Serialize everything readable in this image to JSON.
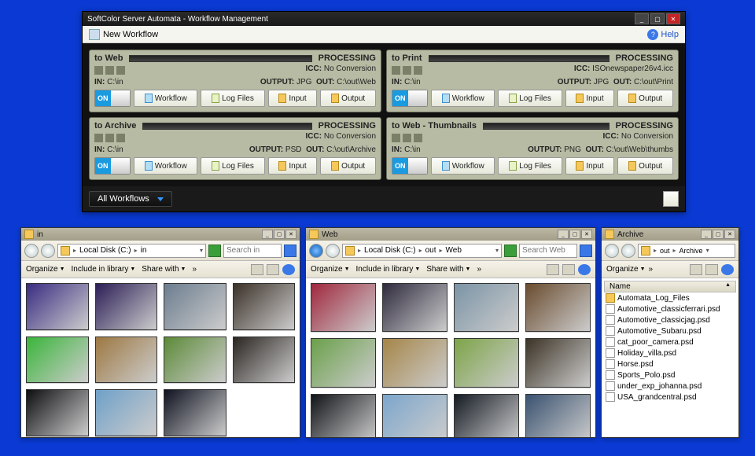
{
  "app": {
    "title": "SoftColor Server Automata - Workflow Management",
    "newWorkflow": "New Workflow",
    "help": "Help",
    "allWorkflows": "All Workflows"
  },
  "labels": {
    "in": "IN:",
    "out": "OUT:",
    "icc": "ICC:",
    "output": "OUTPUT:",
    "workflow": "Workflow",
    "logFiles": "Log Files",
    "input": "Input",
    "outputBtn": "Output",
    "on": "ON"
  },
  "workflows": [
    {
      "name": "to Web",
      "status": "PROCESSING",
      "icc": "No Conversion",
      "in": "C:\\in",
      "output": "JPG",
      "out": "C:\\out\\Web"
    },
    {
      "name": "to Print",
      "status": "PROCESSING",
      "icc": "ISOnewspaper26v4.icc",
      "in": "C:\\in",
      "output": "JPG",
      "out": "C:\\out\\Print"
    },
    {
      "name": "to Archive",
      "status": "PROCESSING",
      "icc": "No Conversion",
      "in": "C:\\in",
      "output": "PSD",
      "out": "C:\\out\\Archive"
    },
    {
      "name": "to Web - Thumbnails",
      "status": "PROCESSING",
      "icc": "No Conversion",
      "in": "C:\\in",
      "output": "PNG",
      "out": "C:\\out\\Web\\thumbs"
    }
  ],
  "explorer": {
    "organize": "Organize",
    "includeLib": "Include in library",
    "shareWith": "Share with",
    "nameCol": "Name"
  },
  "e1": {
    "title": "in",
    "breadcrumb": [
      "Local Disk (C:)",
      "in"
    ],
    "searchPlaceholder": "Search in",
    "thumbColors": [
      "#3a2c82",
      "#2b1e56",
      "#6c7d8f",
      "#3b3128",
      "#3ab53a",
      "#9d7842",
      "#5c8a38",
      "#2a2521",
      "#0e0e12",
      "#6fa0c8",
      "#0f1220"
    ]
  },
  "e2": {
    "title": "Web",
    "breadcrumb": [
      "Local Disk (C:)",
      "out",
      "Web"
    ],
    "searchPlaceholder": "Search Web",
    "thumbColors": [
      "#a0283e",
      "#2f2b3e",
      "#7b94a6",
      "#6a4c2f",
      "#6aa04a",
      "#a58548",
      "#7da448",
      "#3c3326",
      "#111418",
      "#7ca6cc",
      "#151b24",
      "#3a5270"
    ]
  },
  "e3": {
    "title": "Archive",
    "breadcrumb": [
      "out",
      "Archive"
    ],
    "files": [
      {
        "name": "Automata_Log_Files",
        "type": "folder"
      },
      {
        "name": "Automotive_classicferrari.psd",
        "type": "file"
      },
      {
        "name": "Automotive_classicjag.psd",
        "type": "file"
      },
      {
        "name": "Automotive_Subaru.psd",
        "type": "file"
      },
      {
        "name": "cat_poor_camera.psd",
        "type": "file"
      },
      {
        "name": "Holiday_villa.psd",
        "type": "file"
      },
      {
        "name": "Horse.psd",
        "type": "file"
      },
      {
        "name": "Sports_Polo.psd",
        "type": "file"
      },
      {
        "name": "under_exp_johanna.psd",
        "type": "file"
      },
      {
        "name": "USA_grandcentral.psd",
        "type": "file"
      }
    ]
  }
}
